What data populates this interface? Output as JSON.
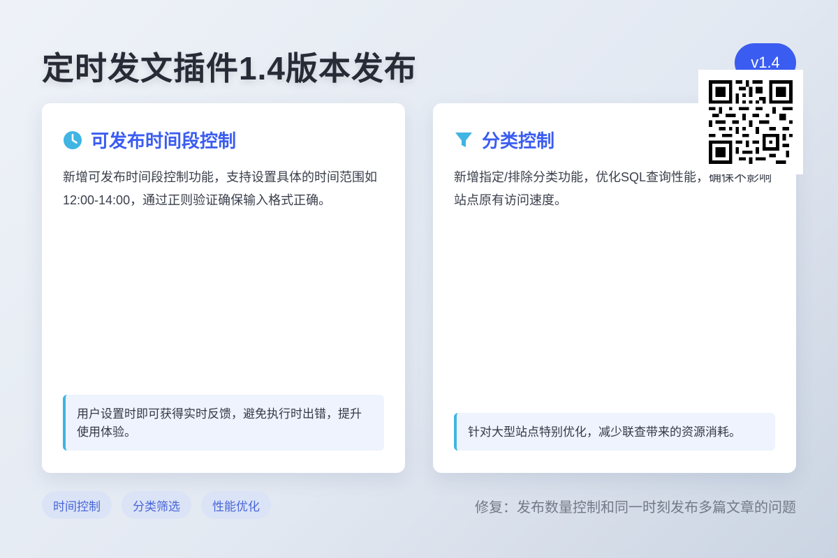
{
  "header": {
    "title": "定时发文插件1.4版本发布",
    "version_badge": "v1.4"
  },
  "cards": [
    {
      "icon": "clock-icon",
      "title": "可发布时间段控制",
      "body": "新增可发布时间段控制功能，支持设置具体的时间范围如12:00-14:00，通过正则验证确保输入格式正确。",
      "note": "用户设置时即可获得实时反馈，避免执行时出错，提升使用体验。"
    },
    {
      "icon": "filter-icon",
      "title": "分类控制",
      "body": "新增指定/排除分类功能，优化SQL查询性能，确保不影响站点原有访问速度。",
      "note": "针对大型站点特别优化，减少联查带来的资源消耗。"
    }
  ],
  "tags": [
    "时间控制",
    "分类筛选",
    "性能优化"
  ],
  "footer": {
    "fix_note": "修复：发布数量控制和同一时刻发布多篇文章的问题"
  },
  "colors": {
    "accent": "#3b5cf0",
    "icon": "#40b4e2",
    "note_bg": "#eef3fd",
    "tag_bg": "#dbe3f6"
  }
}
